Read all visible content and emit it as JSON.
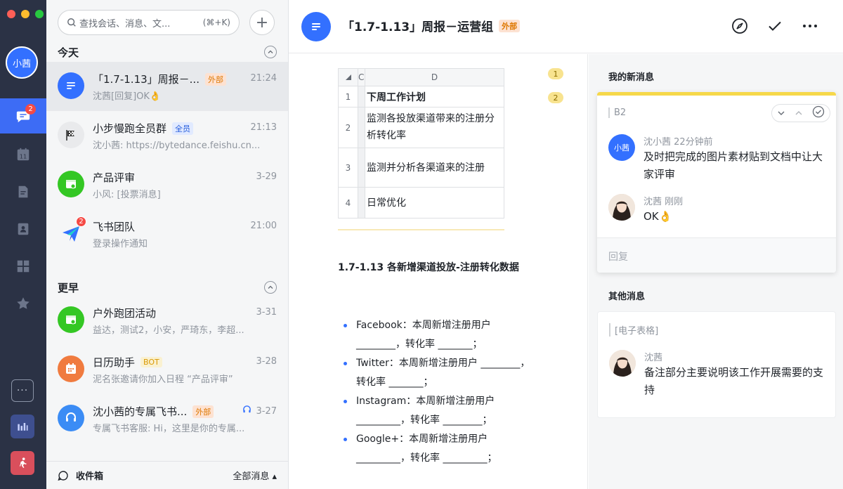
{
  "user": {
    "avatar_label": "小茜"
  },
  "rail": {
    "chat_badge": "2",
    "calendar_day": "11"
  },
  "search": {
    "placeholder": "查找会话、消息、文...",
    "shortcut": "(⌘+K)"
  },
  "sections": {
    "today": "今天",
    "earlier": "更早"
  },
  "chats": [
    {
      "name": "「1.7-1.13」周报－...",
      "tag": "外部",
      "time": "21:24",
      "preview": "沈茜[回复]OK👌"
    },
    {
      "name": "小步慢跑全员群",
      "tag": "全员",
      "time": "21:13",
      "preview": "沈小茜: https://bytedance.feishu.cn..."
    },
    {
      "name": "产品评审",
      "tag": "",
      "time": "3-29",
      "preview": "小风: [投票消息]"
    },
    {
      "name": "飞书团队",
      "tag": "",
      "time": "21:00",
      "preview": "登录操作通知",
      "badge": "2"
    },
    {
      "name": "户外跑团活动",
      "tag": "",
      "time": "3-31",
      "preview": "益达，测试2，小安，严琦东，李超..."
    },
    {
      "name": "日历助手",
      "tag": "BOT",
      "time": "3-28",
      "preview": "泥名张邀请你加入日程 “产品评审”"
    },
    {
      "name": "沈小茜的专属飞书...",
      "tag": "外部",
      "time": "3-27",
      "preview": "专属飞书客服: Hi，这里是你的专属..."
    }
  ],
  "footer": {
    "inbox": "收件箱",
    "all_messages": "全部消息 ▴"
  },
  "header": {
    "title": "「1.7-1.13」周报－运营组",
    "tag": "外部"
  },
  "sheet": {
    "col_c": "C",
    "col_d": "D",
    "rows": [
      {
        "n": "1",
        "text": "下周工作计划"
      },
      {
        "n": "2",
        "text": "监测各投放渠道带来的注册分析转化率"
      },
      {
        "n": "3",
        "text": "监测并分析各渠道来的注册"
      },
      {
        "n": "4",
        "text": "日常优化"
      }
    ]
  },
  "bubbles": [
    "1",
    "2"
  ],
  "doc": {
    "heading": "1.7-1.13 各新增渠道投放-注册转化数据",
    "items": [
      "Facebook：本周新增注册用户 ________，转化率 _______；",
      "Twitter：本周新增注册用户 ________，转化率 _______；",
      "Instagram：本周新增注册用户 _________，转化率 ________；",
      "Google+：本周新增注册用户 _________，转化率 _________；"
    ]
  },
  "comments": {
    "mine_label": "我的新消息",
    "other_label": "其他消息",
    "card1": {
      "ref": "B2",
      "msgs": [
        {
          "avatar": "小茜",
          "meta": "沈小茜 22分钟前",
          "body": "及时把完成的图片素材贴到文档中让大家评审"
        },
        {
          "avatar": "",
          "meta": "沈茜 刚刚",
          "body": "OK👌"
        }
      ],
      "reply_placeholder": "回复"
    },
    "card2": {
      "ref": "[电子表格]",
      "msgs": [
        {
          "avatar": "",
          "meta": "沈茜",
          "body": "备注部分主要说明该工作开展需要的支持"
        }
      ]
    }
  },
  "colors": {
    "accent": "#3370ff",
    "rail": "#2b3245",
    "comment_highlight": "#f6d84a"
  }
}
